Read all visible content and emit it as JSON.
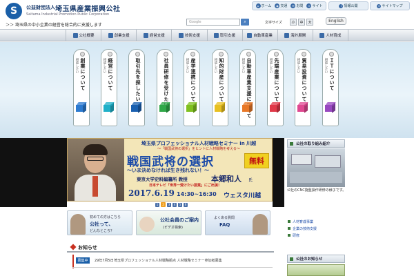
{
  "header": {
    "logo_char": "S",
    "org_type": "公益財団法人",
    "org_name": "埼玉県産業振興公社",
    "org_en": "Saitama Industrial Promotion Public Corporation",
    "tagline": "＞＞ 埼玉県の中小企業の経営を総合的に支援します",
    "quick_icons": [
      {
        "icon": "home-icon",
        "label": "ホーム"
      },
      {
        "icon": "map-icon",
        "label": "交通"
      },
      {
        "icon": "mail-icon",
        "label": "お問"
      },
      {
        "icon": "sitemap-icon",
        "label": "サイト"
      }
    ],
    "right_links": [
      {
        "icon": "info-icon",
        "label": "情報公開"
      },
      {
        "icon": "sitemap-icon",
        "label": "サイトマップ"
      }
    ],
    "search_placeholder": "Google",
    "fontsize_label": "文字サイズ",
    "fontsize_buttons": [
      "小",
      "中",
      "大"
    ],
    "english_label": "English"
  },
  "nav": [
    {
      "icon": "company-icon",
      "label": "公社概要"
    },
    {
      "icon": "startup-icon",
      "label": "創業支援"
    },
    {
      "icon": "business-icon",
      "label": "経営支援"
    },
    {
      "icon": "tech-icon",
      "label": "技術支援"
    },
    {
      "icon": "trade-icon",
      "label": "取引支援"
    },
    {
      "icon": "car-icon",
      "label": "自動車産業"
    },
    {
      "icon": "global-icon",
      "label": "海外展開"
    },
    {
      "icon": "training-icon",
      "label": "人材育成"
    }
  ],
  "hero_tags": [
    {
      "main": "創業について",
      "sub": "相談したい",
      "color": "#2c7ad0"
    },
    {
      "main": "経営について",
      "sub": "相談したい",
      "color": "#20b0c8"
    },
    {
      "main": "取引先を探したい",
      "sub": "",
      "color": "#1a60b0"
    },
    {
      "main": "社員研修を受けたい",
      "sub": "",
      "color": "#30a848"
    },
    {
      "main": "産学連携について",
      "sub": "相談したい",
      "color": "#80c020"
    },
    {
      "main": "知的財産について",
      "sub": "相談したい",
      "color": "#e8c020"
    },
    {
      "main": "自動車産業支援について",
      "sub": "相談したい",
      "color": "#e87828"
    },
    {
      "main": "先端産業について",
      "sub": "相談したい",
      "color": "#e03848"
    },
    {
      "main": "貿易投資について",
      "sub": "相談したい",
      "color": "#e04890"
    },
    {
      "main": "ＩＴについて",
      "sub": "相談したい",
      "color": "#9848c0"
    }
  ],
  "banner": {
    "title": "埼玉県プロフェッショナル人材戦略セミナー in 川越",
    "subtitle": "～「戦国武将の選択」をヒントに人材戦略を考える～",
    "main": "戦国武将の選択",
    "free": "無料",
    "catch": "～いま決めなければ生き残れない！～",
    "speaker_aff": "東京大学史料編纂所 教授",
    "speaker_name": "本郷和人",
    "speaker_hon": "氏",
    "tv": "日本テレビ「世界一受けたい授業」にご出演！",
    "date": "2017.6.19",
    "time": "14:30~16:30",
    "venue": "ウェスタ川越"
  },
  "dots": [
    "1",
    "2",
    "3",
    "4",
    "5",
    "6"
  ],
  "quick_banners": [
    {
      "t1": "初めての方はこちら",
      "t2": "公社って、",
      "t3": "どんなところ？"
    },
    {
      "t1": "公社会員のご案内",
      "t2": "(ビデオ検索)"
    },
    {
      "t1": "よくある質問",
      "t2": "FAQ"
    }
  ],
  "news": {
    "title": "お知らせ",
    "badge": "募集中",
    "date": "29年7月5日",
    "text": "埼玉県プロフェッショナル人材戦略拠点 人材戦略セミナー参加者募集"
  },
  "sidebar": {
    "head1": "公社の取り組み紹介",
    "caption": "公社のCNC旋盤操作研修の様子です。",
    "links": [
      "人材育成事業",
      "企業の技術支援",
      "研修"
    ],
    "head2": "公社のお知らせ"
  },
  "colors": {
    "brand": "#1a5fa8",
    "nav_bg": "#cfd6de",
    "accent_red": "#c83020"
  }
}
